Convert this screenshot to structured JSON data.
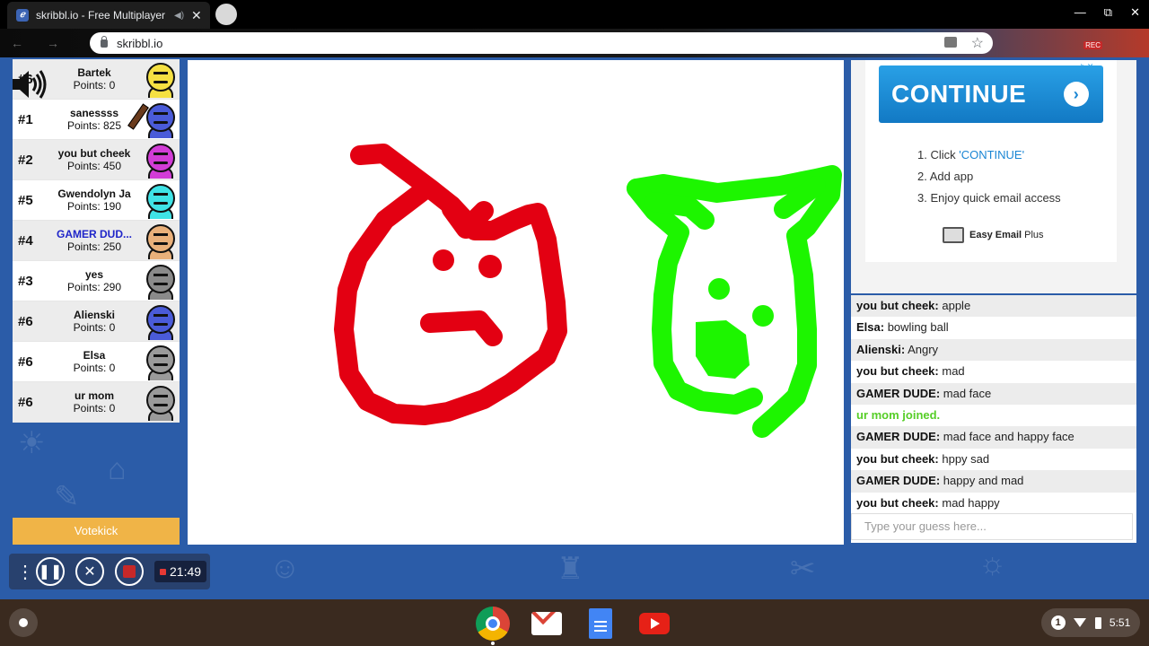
{
  "browser": {
    "tab_title": "skribbl.io - Free Multiplayer D",
    "url": "skribbl.io",
    "rec_badge": "REC"
  },
  "players": [
    {
      "rank": "#6",
      "name": "Bartek",
      "points": "Points: 0",
      "color": "#f5e042",
      "me": false
    },
    {
      "rank": "#1",
      "name": "sanessss",
      "points": "Points: 825",
      "color": "#4a5bd8",
      "me": false,
      "drawing": true
    },
    {
      "rank": "#2",
      "name": "you but cheek",
      "points": "Points: 450",
      "color": "#d23cd6",
      "me": false
    },
    {
      "rank": "#5",
      "name": "Gwendolyn Ja",
      "points": "Points: 190",
      "color": "#3fe3e6",
      "me": false
    },
    {
      "rank": "#4",
      "name": "GAMER DUD...",
      "points": "Points: 250",
      "color": "#e9b07a",
      "me": true
    },
    {
      "rank": "#3",
      "name": "yes",
      "points": "Points: 290",
      "color": "#8a8a8a",
      "me": false
    },
    {
      "rank": "#6",
      "name": "Alienski",
      "points": "Points: 0",
      "color": "#4a5bd8",
      "me": false
    },
    {
      "rank": "#6",
      "name": "Elsa",
      "points": "Points: 0",
      "color": "#9a9a9a",
      "me": false
    },
    {
      "rank": "#6",
      "name": "ur mom",
      "points": "Points: 0",
      "color": "#9a9a9a",
      "me": false
    }
  ],
  "votekick_label": "Votekick",
  "recorder": {
    "time": "21:49"
  },
  "ad": {
    "cta": "CONTINUE",
    "step1_prefix": "1. Click ",
    "step1_link": "'CONTINUE'",
    "step2": "2. Add app",
    "step3": "3. Enjoy quick email access",
    "brand": "Easy Email",
    "brand_suffix": "Plus"
  },
  "chat": [
    {
      "user": "you but cheek:",
      "text": " apple"
    },
    {
      "user": "Elsa:",
      "text": " bowling ball"
    },
    {
      "user": "Alienski:",
      "text": " Angry"
    },
    {
      "user": "you but cheek:",
      "text": " mad"
    },
    {
      "user": "GAMER DUDE:",
      "text": " mad face"
    },
    {
      "user": "",
      "text": "ur mom joined.",
      "join": true
    },
    {
      "user": "GAMER DUDE:",
      "text": " mad face and happy face"
    },
    {
      "user": "you but cheek:",
      "text": " hppy sad"
    },
    {
      "user": "GAMER DUDE:",
      "text": " happy and mad"
    },
    {
      "user": "you but cheek:",
      "text": " mad happy"
    }
  ],
  "guess_placeholder": "Type your guess here...",
  "shelf": {
    "time": "5:51"
  },
  "colors": {
    "red_drawing": "#e30012",
    "green_drawing": "#1df500",
    "accent_blue": "#1a86d4",
    "votekick": "#f0b447"
  }
}
